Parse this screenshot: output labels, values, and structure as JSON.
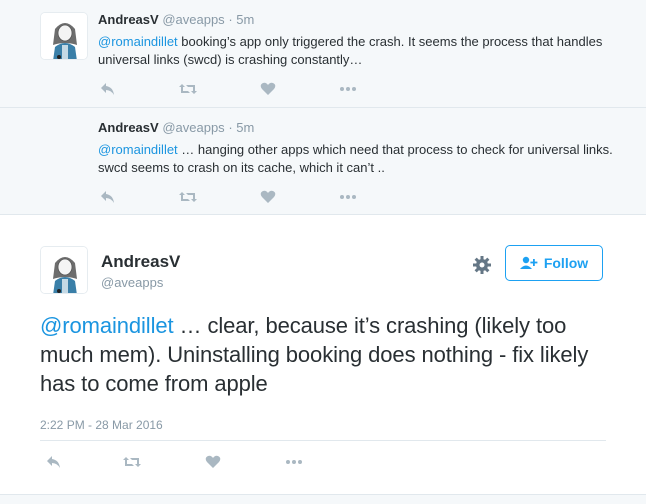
{
  "tweets": [
    {
      "name": "AndreasV",
      "handle": "@aveapps",
      "time": "5m",
      "mention": "@romaindillet",
      "text": " booking’s app only triggered the crash. It seems the process that handles universal links (swcd) is crashing constantly…"
    },
    {
      "name": "AndreasV",
      "handle": "@aveapps",
      "time": "5m",
      "mention": "@romaindillet",
      "text": " … hanging other apps which need that process to check for universal links. swcd seems to crash on its cache, which it can’t .."
    }
  ],
  "main": {
    "name": "AndreasV",
    "handle": "@aveapps",
    "follow_label": "Follow",
    "mention": "@romaindillet",
    "text": " … clear, because it’s crashing (likely too much mem). Uninstalling booking does nothing - fix likely has to come from apple",
    "timestamp": "2:22 PM - 28 Mar 2016"
  },
  "colors": {
    "accent": "#1da1f2",
    "mention": "#1b95e0",
    "muted": "#8899a6",
    "icon": "#aab8c2",
    "background_alt": "#f5f8fa"
  },
  "icons": [
    "reply-icon",
    "retweet-icon",
    "like-icon",
    "more-icon",
    "gear-icon",
    "follow-person-icon"
  ]
}
